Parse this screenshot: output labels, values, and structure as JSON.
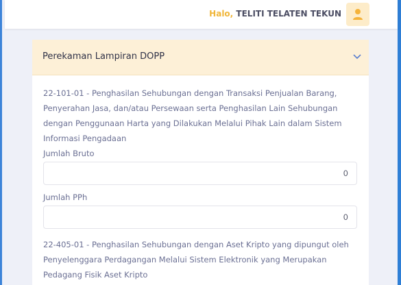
{
  "header": {
    "greeting": "Halo,",
    "username": "TELITI TELATEN TEKUN",
    "avatar_icon": "user-icon"
  },
  "panel": {
    "title": "Perekaman Lampiran DOPP",
    "chevron_icon": "chevron-down-icon",
    "sections": [
      {
        "description": "22-101-01 - Penghasilan Sehubungan dengan Transaksi Penjualan Barang, Penyerahan Jasa, dan/atau Persewaan serta Penghasilan Lain Sehubungan dengan Penggunaan Harta yang Dilakukan Melalui Pihak Lain dalam Sistem Informasi Pengadaan",
        "bruto_label": "Jumlah Bruto",
        "bruto_value": "0",
        "pph_label": "Jumlah PPh",
        "pph_value": "0"
      },
      {
        "description": "22-405-01 - Penghasilan Sehubungan dengan Aset Kripto yang dipungut oleh Penyelenggara Perdagangan Melalui Sistem Elektronik yang Merupakan Pedagang Fisik Aset Kripto"
      }
    ]
  },
  "colors": {
    "accent_blue": "#2f7fd6",
    "greeting_gold": "#f0b63a",
    "header_bg": "#fdf0d7"
  }
}
